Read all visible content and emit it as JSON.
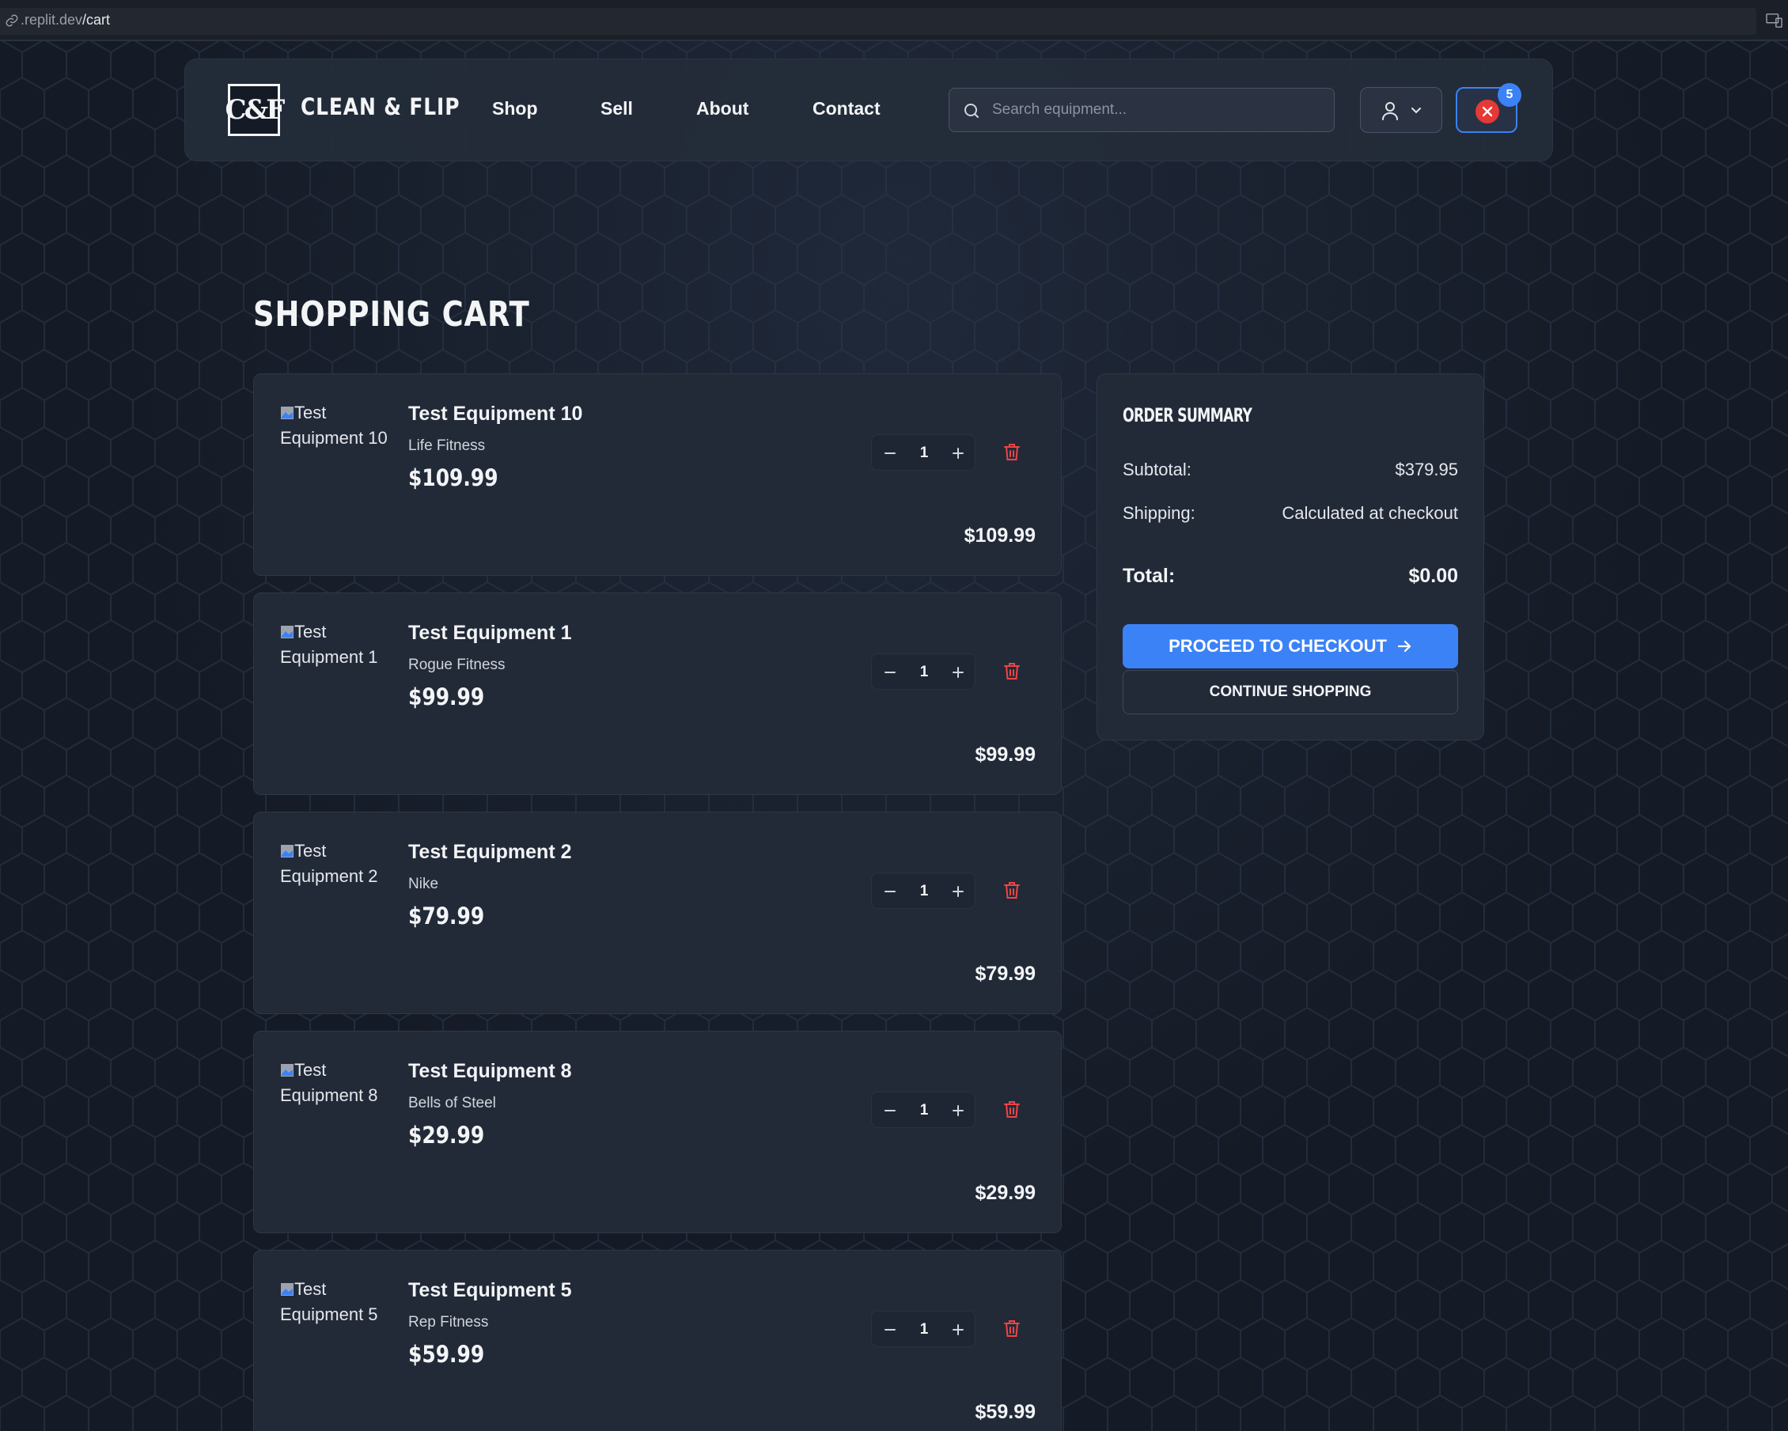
{
  "browser": {
    "url_prefix": ".replit.dev",
    "url_path": "/cart"
  },
  "header": {
    "logo_text": "C&F",
    "brand": "CLEAN & FLIP",
    "nav": [
      "Shop",
      "Sell",
      "About",
      "Contact"
    ],
    "search_placeholder": "Search equipment...",
    "cart_count": "5"
  },
  "page": {
    "title": "SHOPPING CART"
  },
  "cart_items": [
    {
      "alt": "Test Equipment 10",
      "name": "Test Equipment 10",
      "brand": "Life Fitness",
      "price": "$109.99",
      "qty": "1",
      "line_total": "$109.99"
    },
    {
      "alt": "Test Equipment 1",
      "name": "Test Equipment 1",
      "brand": "Rogue Fitness",
      "price": "$99.99",
      "qty": "1",
      "line_total": "$99.99"
    },
    {
      "alt": "Test Equipment 2",
      "name": "Test Equipment 2",
      "brand": "Nike",
      "price": "$79.99",
      "qty": "1",
      "line_total": "$79.99"
    },
    {
      "alt": "Test Equipment 8",
      "name": "Test Equipment 8",
      "brand": "Bells of Steel",
      "price": "$29.99",
      "qty": "1",
      "line_total": "$29.99"
    },
    {
      "alt": "Test Equipment 5",
      "name": "Test Equipment 5",
      "brand": "Rep Fitness",
      "price": "$59.99",
      "qty": "1",
      "line_total": "$59.99"
    }
  ],
  "summary": {
    "title": "ORDER SUMMARY",
    "subtotal_label": "Subtotal:",
    "subtotal_value": "$379.95",
    "shipping_label": "Shipping:",
    "shipping_value": "Calculated at checkout",
    "total_label": "Total:",
    "total_value": "$0.00",
    "checkout_label": "PROCEED TO CHECKOUT",
    "continue_label": "CONTINUE SHOPPING"
  },
  "colors": {
    "background": "#151b26",
    "card": "#222a38",
    "accent": "#3b82f6",
    "danger": "#e53935"
  }
}
